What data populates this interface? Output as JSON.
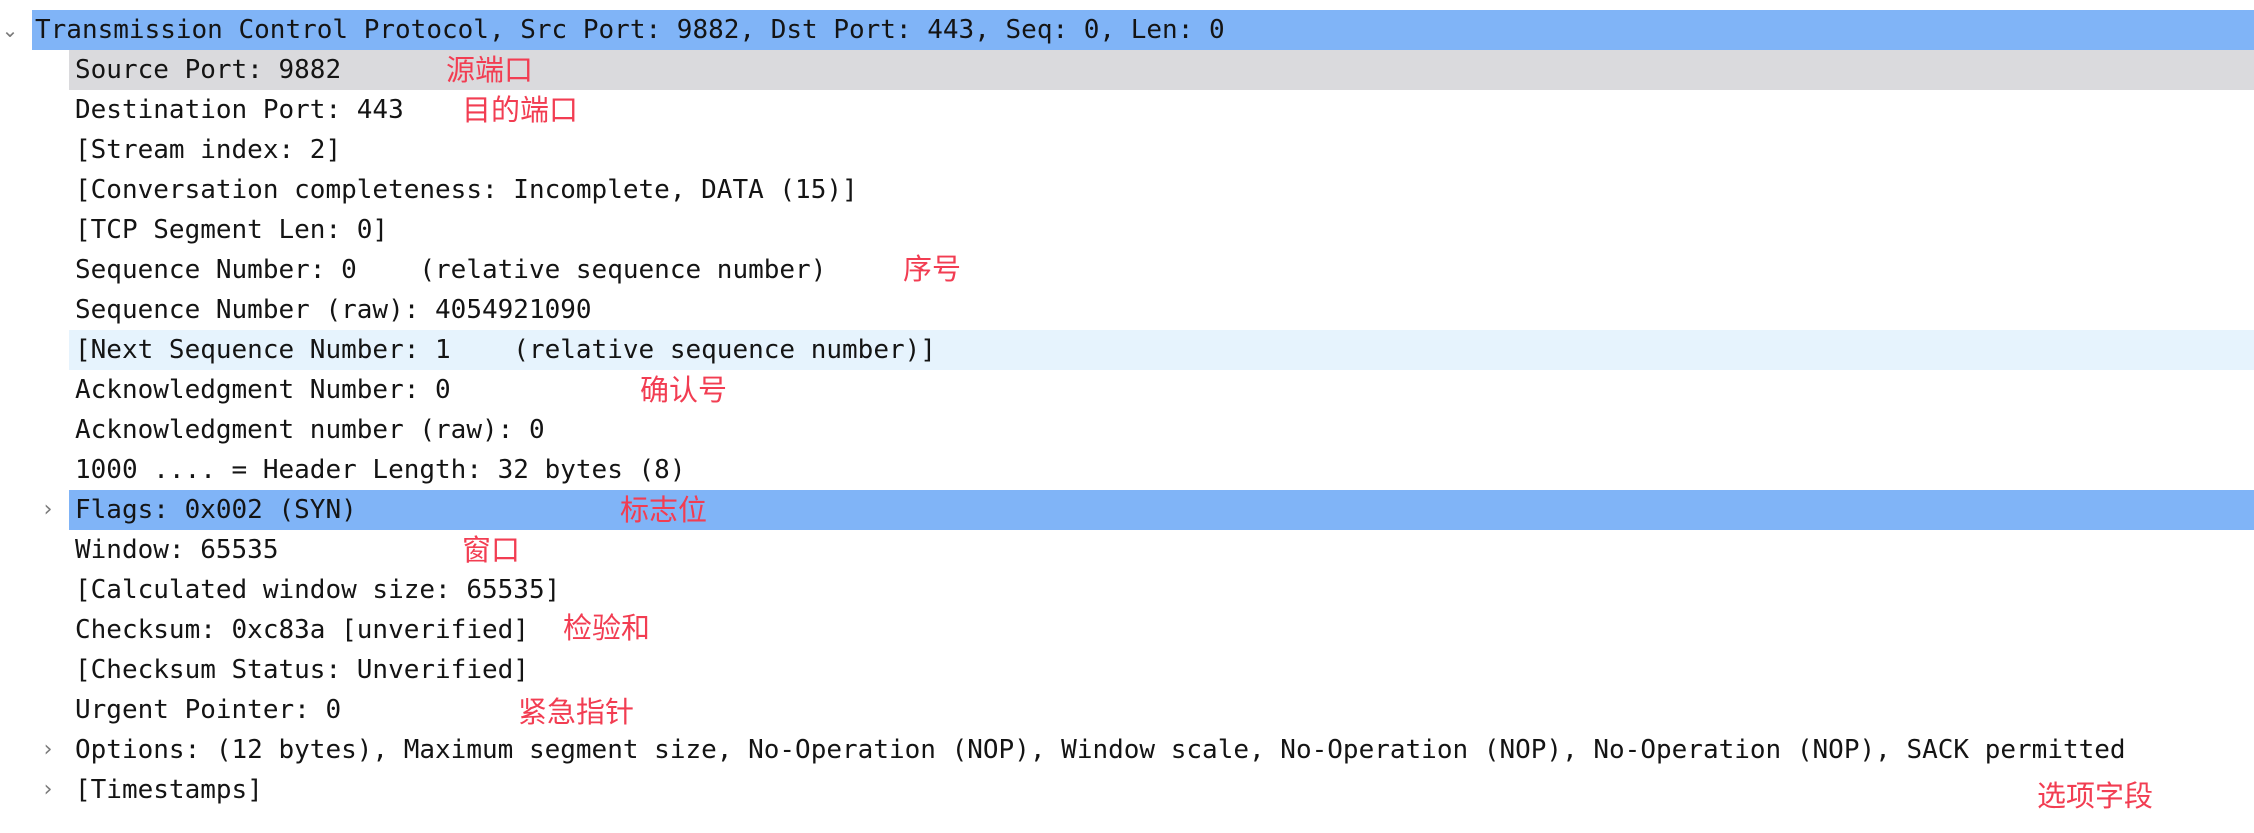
{
  "tree": {
    "header": "Transmission Control Protocol, Src Port: 9882, Dst Port: 443, Seq: 0, Len: 0",
    "fields": [
      "Source Port: 9882",
      "Destination Port: 443",
      "[Stream index: 2]",
      "[Conversation completeness: Incomplete, DATA (15)]",
      "[TCP Segment Len: 0]",
      "Sequence Number: 0    (relative sequence number)",
      "Sequence Number (raw): 4054921090",
      "[Next Sequence Number: 1    (relative sequence number)]",
      "Acknowledgment Number: 0",
      "Acknowledgment number (raw): 0",
      "1000 .... = Header Length: 32 bytes (8)",
      "Flags: 0x002 (SYN)",
      "Window: 65535",
      "[Calculated window size: 65535]",
      "Checksum: 0xc83a [unverified]",
      "[Checksum Status: Unverified]",
      "Urgent Pointer: 0",
      "Options: (12 bytes), Maximum segment size, No-Operation (NOP), Window scale, No-Operation (NOP), No-Operation (NOP), SACK permitted",
      "[Timestamps]"
    ]
  },
  "icons": {
    "expanded": "chevron-down-icon",
    "collapsed": "chevron-right-icon"
  },
  "annotations": {
    "source_port": "源端口",
    "destination_port": "目的端口",
    "sequence_number": "序号",
    "ack_number": "确认号",
    "flags": "标志位",
    "window": "窗口",
    "checksum": "检验和",
    "urgent_pointer": "紧急指针",
    "options": "选项字段"
  },
  "colors": {
    "selected_blue": "#80b4f7",
    "selected_gray": "#dadadd",
    "hover_light": "#e6f3fd",
    "annotation_red": "#f23d52",
    "text": "#141414"
  }
}
